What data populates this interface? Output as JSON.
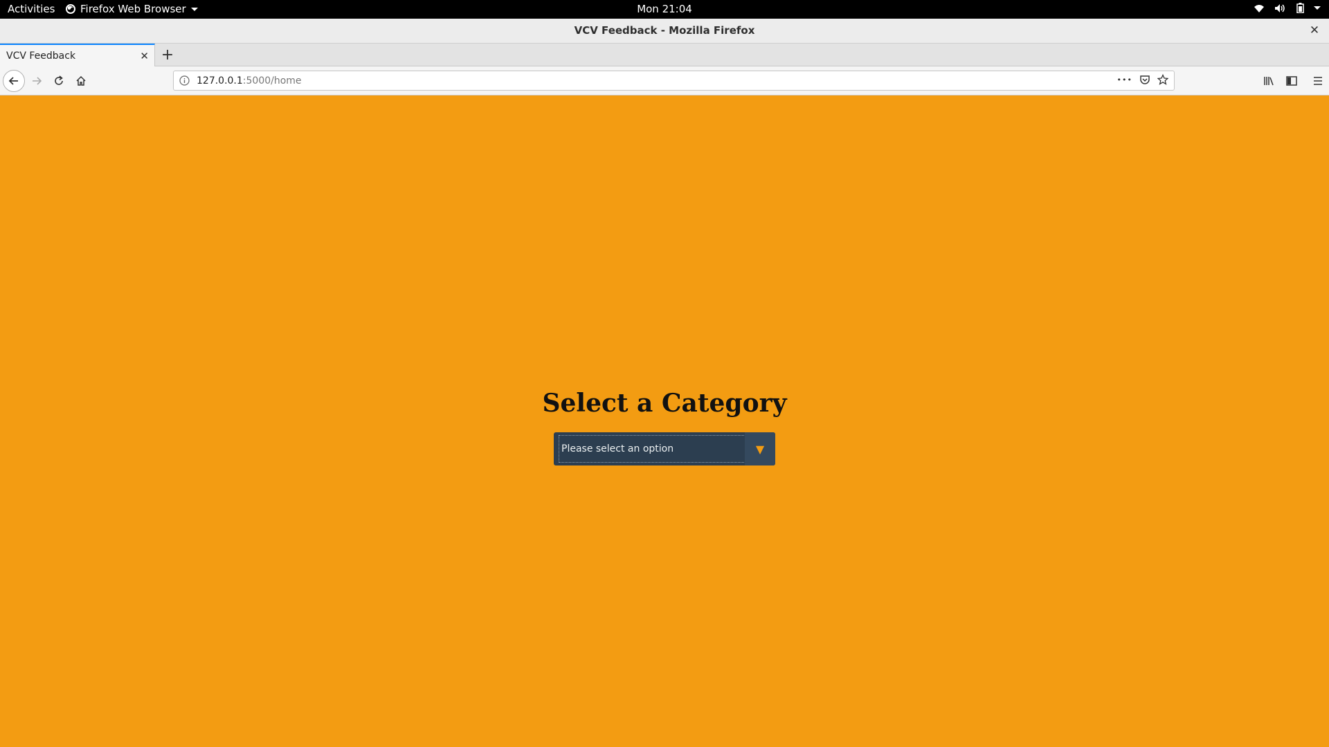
{
  "system_bar": {
    "activities": "Activities",
    "app_name": "Firefox Web Browser",
    "clock": "Mon 21:04"
  },
  "window": {
    "title": "VCV Feedback - Mozilla Firefox",
    "close_icon": "✕"
  },
  "tabs": [
    {
      "label": "VCV Feedback",
      "active": true,
      "close_icon": "✕"
    }
  ],
  "new_tab_icon": "+",
  "address_bar": {
    "host": "127.0.0.1",
    "path": ":5000/home",
    "page_actions_icon": "•••"
  },
  "page": {
    "heading": "Select a Category",
    "select": {
      "selected": "Please select an option",
      "arrow_icon": "▼"
    }
  },
  "colors": {
    "page_background": "#f39c12",
    "select_background": "#2c3e50",
    "select_arrow_background": "#34495e",
    "select_arrow": "#f39c12",
    "tab_accent": "#0a84ff"
  }
}
